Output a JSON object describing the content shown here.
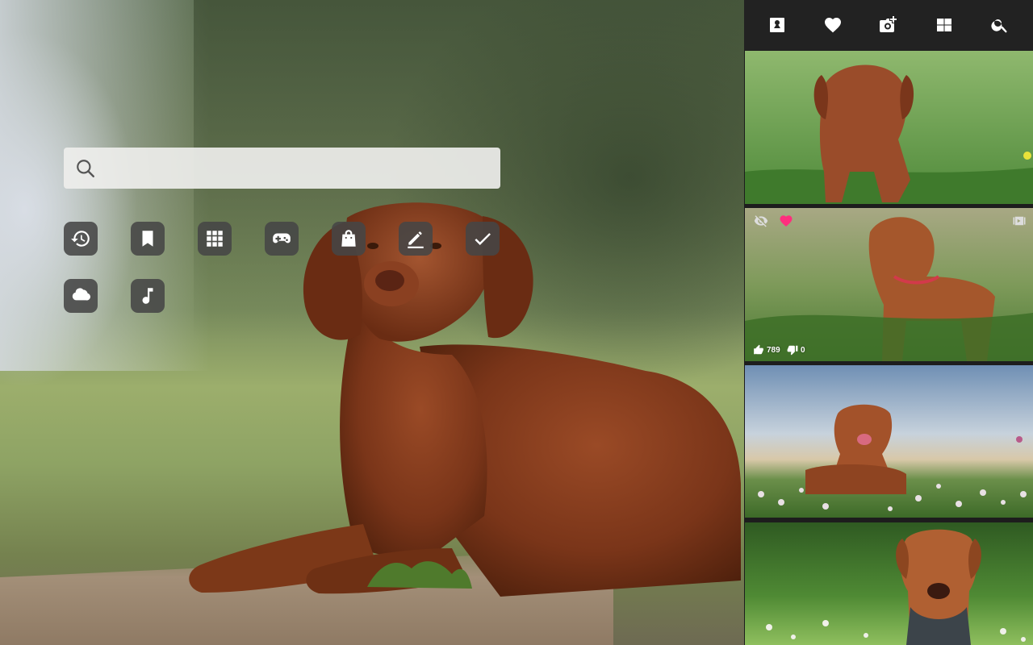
{
  "search": {
    "placeholder": ""
  },
  "shortcuts": [
    {
      "name": "history",
      "icon": "history-icon"
    },
    {
      "name": "bookmarks",
      "icon": "bookmark-icon"
    },
    {
      "name": "apps",
      "icon": "apps-grid-icon"
    },
    {
      "name": "games",
      "icon": "gamepad-icon"
    },
    {
      "name": "shopping",
      "icon": "shopping-bag-icon"
    },
    {
      "name": "notes",
      "icon": "pencil-icon"
    },
    {
      "name": "tasks",
      "icon": "checkmark-icon"
    },
    {
      "name": "weather",
      "icon": "weather-cloud-icon"
    },
    {
      "name": "music",
      "icon": "music-note-icon"
    }
  ],
  "sidebar": {
    "toolbar": [
      "wallpaper-icon",
      "heart-icon",
      "add-photo-icon",
      "windows-icon",
      "search-icon"
    ],
    "thumbnails": [
      {
        "id": "thumb-1"
      },
      {
        "id": "thumb-2",
        "likes": "789",
        "dislikes": "0",
        "favorited": true
      },
      {
        "id": "thumb-3"
      },
      {
        "id": "thumb-4"
      }
    ]
  },
  "colors": {
    "favorite": "#ff2e7e",
    "sidebar_bg": "#1d1d1d",
    "tile_bg": "#464646"
  }
}
